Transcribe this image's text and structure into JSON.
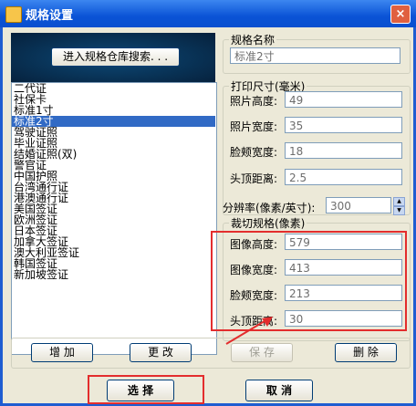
{
  "window": {
    "title": "规格设置",
    "close_label": "×"
  },
  "warehouse_button": "进入规格仓库搜索. . .",
  "specs": [
    "二代证",
    "社保卡",
    "标准1寸",
    "标准2寸",
    "驾驶证照",
    "毕业证照",
    "结婚证照(双)",
    "警官证",
    "中国护照",
    "台湾通行证",
    "港澳通行证",
    "美国签证",
    "欧洲签证",
    "日本签证",
    "加拿大签证",
    "澳大利亚签证",
    "韩国签证",
    "新加坡签证"
  ],
  "selected_index": 3,
  "name_group": {
    "legend": "规格名称",
    "value": "标准2寸"
  },
  "print_group": {
    "legend": "打印尺寸(毫米)",
    "rows": [
      {
        "label": "照片高度:",
        "value": "49"
      },
      {
        "label": "照片宽度:",
        "value": "35"
      },
      {
        "label": "脸颊宽度:",
        "value": "18"
      },
      {
        "label": "头顶距离:",
        "value": "2.5"
      }
    ]
  },
  "resolution": {
    "label": "分辨率(像素/英寸):",
    "value": "300"
  },
  "crop_group": {
    "legend": "裁切规格(像素)",
    "rows": [
      {
        "label": "图像高度:",
        "value": "579"
      },
      {
        "label": "图像宽度:",
        "value": "413"
      },
      {
        "label": "脸颊宽度:",
        "value": "213"
      },
      {
        "label": "头顶距离:",
        "value": "30"
      }
    ]
  },
  "buttons": {
    "add": "增 加",
    "edit": "更 改",
    "save": "保 存",
    "delete": "删 除",
    "select": "选 择",
    "cancel": "取 消"
  },
  "colors": {
    "highlight": "#e32d2d",
    "selection": "#316ac5"
  }
}
